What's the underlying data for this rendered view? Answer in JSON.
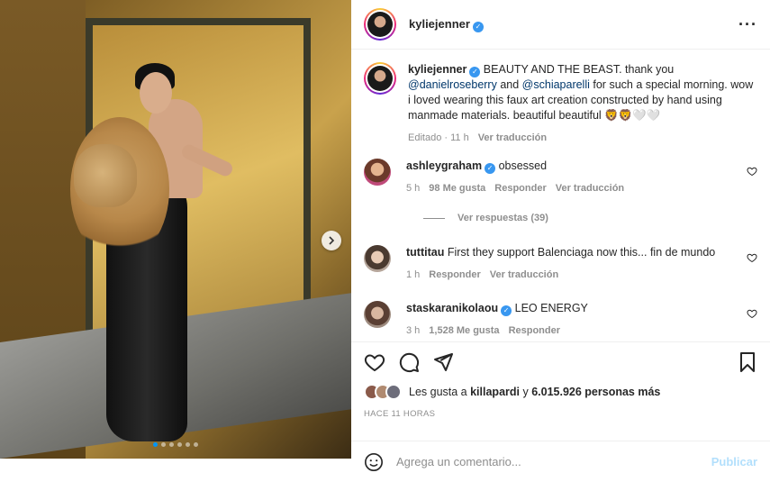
{
  "post": {
    "username": "kyliejenner",
    "more_icon": "more-horizontal-icon",
    "photo_count": 6,
    "active_photo_index": 0
  },
  "caption": {
    "username": "kyliejenner",
    "text_1": " BEAUTY AND THE BEAST. thank you ",
    "mention_1": "@danielroseberry",
    "text_2": " and ",
    "mention_2": "@schiaparelli",
    "text_3": " for such a special morning. wow i loved wearing this faux art creation constructed by hand using manmade materials. beautiful beautiful 🦁🦁🤍🤍",
    "edited": "Editado",
    "time": "11 h",
    "translate": "Ver traducción"
  },
  "comments": [
    {
      "username": "ashleygraham",
      "verified": true,
      "text": "obsessed",
      "time": "5 h",
      "likes": "98 Me gusta",
      "reply": "Responder",
      "translate": "Ver traducción",
      "avatar_color": "#c04a7a"
    },
    {
      "username": "tuttitau",
      "verified": false,
      "text": "First they support Balenciaga now this... fin de mundo",
      "time": "1 h",
      "reply": "Responder",
      "translate": "Ver traducción",
      "avatar_color": "#8b7466"
    },
    {
      "username": "staskaranikolaou",
      "verified": true,
      "text": "LEO ENERGY",
      "time": "3 h",
      "likes": "1,528 Me gusta",
      "reply": "Responder",
      "avatar_color": "#7a5f52"
    }
  ],
  "replies": {
    "label": "Ver respuestas (39)"
  },
  "likes": {
    "prefix": "Les gusta a ",
    "user": "killapardi",
    "middle": " y ",
    "count": "6.015.926 personas más"
  },
  "timestamp": "HACE 11 HORAS",
  "add_comment": {
    "placeholder": "Agrega un comentario...",
    "post_label": "Publicar"
  },
  "colors": {
    "link": "#00376b",
    "verified": "#3897f0",
    "muted": "#8e8e8e",
    "post_disabled": "#b2dffc"
  }
}
